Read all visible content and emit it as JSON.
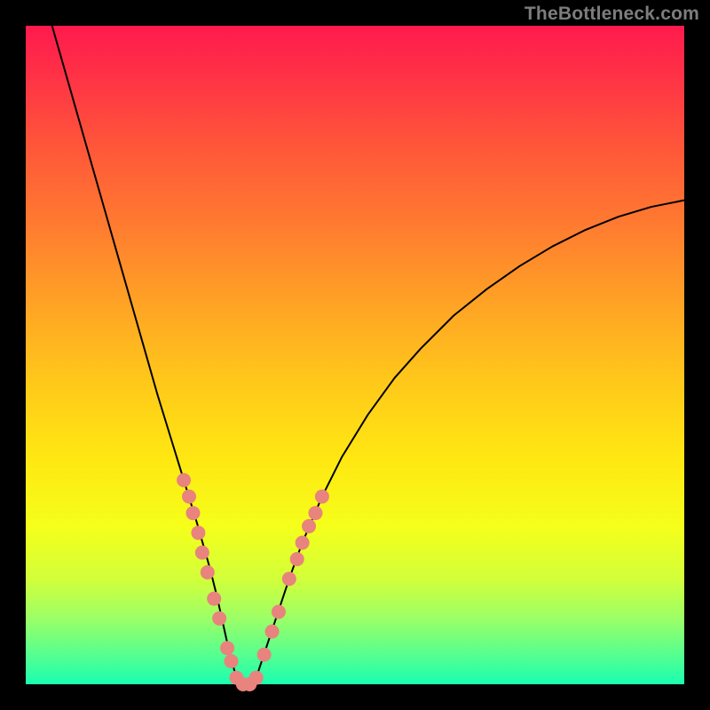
{
  "watermark": "TheBottleneck.com",
  "chart_data": {
    "type": "line",
    "title": "",
    "xlabel": "",
    "ylabel": "",
    "xlim": [
      0,
      100
    ],
    "ylim": [
      0,
      100
    ],
    "background_gradient": {
      "top": "#ff1a4d",
      "bottom": "#1affb0",
      "direction": "vertical"
    },
    "series": [
      {
        "name": "bottleneck-curve",
        "color": "#000000",
        "x": [
          4.0,
          5.0,
          6.0,
          8.0,
          10.0,
          12.0,
          14.0,
          16.0,
          18.0,
          20.0,
          22.0,
          24.0,
          26.0,
          27.0,
          28.0,
          29.0,
          30.0,
          31.0,
          32.0,
          33.0,
          34.0,
          35.0,
          36.0,
          38.0,
          40.0,
          42.0,
          45.0,
          48.0,
          52.0,
          56.0,
          60.0,
          65.0,
          70.0,
          75.0,
          80.0,
          85.0,
          90.0,
          95.0,
          100.0
        ],
        "y": [
          100.0,
          96.5,
          93.0,
          86.0,
          79.0,
          72.0,
          65.0,
          58.0,
          51.0,
          44.0,
          37.5,
          31.0,
          24.5,
          21.0,
          17.5,
          13.5,
          9.0,
          4.5,
          1.0,
          0.0,
          0.0,
          1.0,
          4.0,
          10.0,
          16.0,
          21.5,
          28.5,
          34.5,
          41.0,
          46.5,
          51.0,
          56.0,
          60.0,
          63.5,
          66.5,
          69.0,
          71.0,
          72.5,
          73.5
        ]
      }
    ],
    "markers": {
      "color": "#e8837d",
      "radius_px": 8,
      "points": [
        {
          "x": 24.0,
          "y": 31.0
        },
        {
          "x": 24.8,
          "y": 28.5
        },
        {
          "x": 25.4,
          "y": 26.0
        },
        {
          "x": 26.2,
          "y": 23.0
        },
        {
          "x": 26.8,
          "y": 20.0
        },
        {
          "x": 27.6,
          "y": 17.0
        },
        {
          "x": 28.6,
          "y": 13.0
        },
        {
          "x": 29.4,
          "y": 10.0
        },
        {
          "x": 30.6,
          "y": 5.5
        },
        {
          "x": 31.2,
          "y": 3.5
        },
        {
          "x": 32.0,
          "y": 1.0
        },
        {
          "x": 33.0,
          "y": 0.0
        },
        {
          "x": 34.0,
          "y": 0.0
        },
        {
          "x": 35.0,
          "y": 1.0
        },
        {
          "x": 36.2,
          "y": 4.5
        },
        {
          "x": 37.4,
          "y": 8.0
        },
        {
          "x": 38.4,
          "y": 11.0
        },
        {
          "x": 40.0,
          "y": 16.0
        },
        {
          "x": 41.2,
          "y": 19.0
        },
        {
          "x": 42.0,
          "y": 21.5
        },
        {
          "x": 43.0,
          "y": 24.0
        },
        {
          "x": 44.0,
          "y": 26.0
        },
        {
          "x": 45.0,
          "y": 28.5
        }
      ]
    }
  }
}
